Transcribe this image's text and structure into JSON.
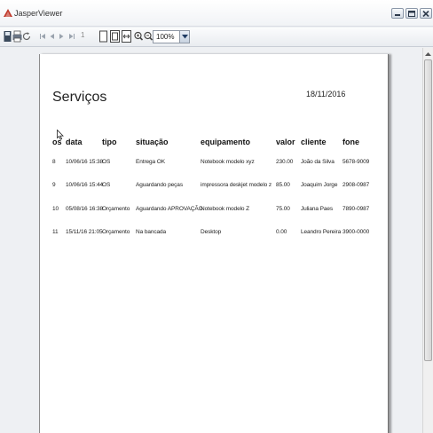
{
  "window": {
    "title": "JasperViewer"
  },
  "toolbar": {
    "page_number": "1",
    "zoom": "100%"
  },
  "report": {
    "title": "Serviços",
    "date": "18/11/2016",
    "columns": [
      "os",
      "data",
      "tipo",
      "situação",
      "equipamento",
      "valor",
      "cliente",
      "fone"
    ],
    "rows": [
      [
        "8",
        "10/06/16 15:38",
        "OS",
        "Entrega OK",
        "Notebook modelo xyz",
        "230.00",
        "João da Silva",
        "5678-9009"
      ],
      [
        "9",
        "10/06/16 15:44",
        "OS",
        "Aguardando peças",
        "impressora deskjet modelo z",
        "85.00",
        "Joaquim Jorge",
        "2908-0987"
      ],
      [
        "10",
        "05/08/16 16:38",
        "Orçamento",
        "Aguardando APROVAÇÃO",
        "Notebook modelo Z",
        "75.00",
        "Juliana Paes",
        "7890-0987"
      ],
      [
        "11",
        "15/11/16 21:05",
        "Orçamento",
        "Na bancada",
        "Desktop",
        "0.00",
        "Leandro Pereira",
        "3900-0000"
      ]
    ]
  }
}
